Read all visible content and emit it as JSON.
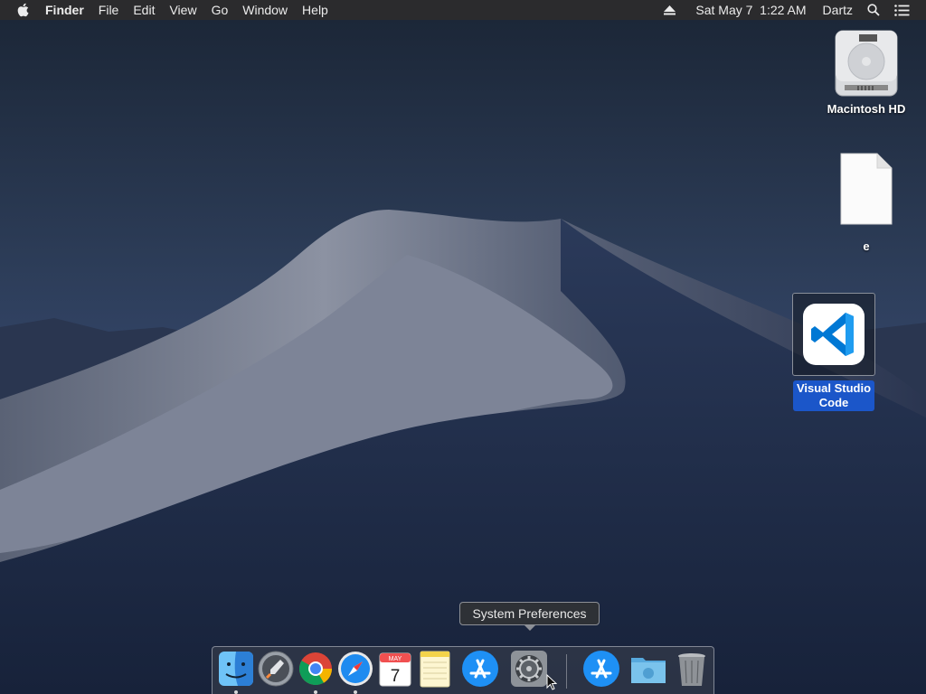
{
  "menubar": {
    "apple_icon": "apple-logo-icon",
    "app_name": "Finder",
    "menus": [
      "File",
      "Edit",
      "View",
      "Go",
      "Window",
      "Help"
    ],
    "eject_icon": "eject-icon",
    "clock": "Sat May 7  1:22 AM",
    "user": "Dartz",
    "search_icon": "spotlight-search-icon",
    "notification_icon": "notification-center-icon"
  },
  "desktop": {
    "icons": [
      {
        "label": "Macintosh HD",
        "icon": "hard-drive-icon"
      },
      {
        "label": "e",
        "icon": "document-icon"
      },
      {
        "label": "Visual Studio\nCode",
        "icon": "vscode-icon",
        "selected": true
      }
    ]
  },
  "tooltip": {
    "text": "System Preferences"
  },
  "dock": {
    "items": [
      {
        "name": "Finder",
        "icon": "finder-icon",
        "running": true
      },
      {
        "name": "Launchpad",
        "icon": "launchpad-icon",
        "running": false
      },
      {
        "name": "Google Chrome",
        "icon": "chrome-icon",
        "running": true
      },
      {
        "name": "Safari",
        "icon": "safari-icon",
        "running": true
      },
      {
        "name": "Calendar",
        "icon": "calendar-icon",
        "running": false,
        "month": "MAY",
        "day": "7"
      },
      {
        "name": "Notes",
        "icon": "notes-icon",
        "running": false
      },
      {
        "name": "App Store",
        "icon": "app-store-icon",
        "running": false
      },
      {
        "name": "System Preferences",
        "icon": "system-preferences-icon",
        "running": false,
        "hovered": true
      },
      {
        "name": "App Store",
        "icon": "app-store-icon",
        "running": false
      },
      {
        "name": "Downloads",
        "icon": "downloads-folder-icon",
        "running": false
      },
      {
        "name": "Trash",
        "icon": "trash-icon",
        "running": false
      }
    ]
  },
  "colors": {
    "menubar": "#2b2b2d",
    "selection": "#1b56c9",
    "vscode_blue": "#0078d4"
  }
}
